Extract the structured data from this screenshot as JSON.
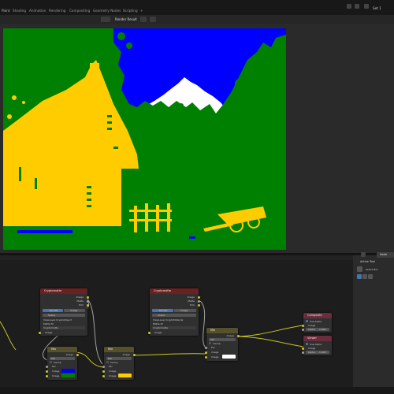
{
  "workspace_tabs": [
    "Paint",
    "Shading",
    "Animation",
    "Rendering",
    "Compositing",
    "Geometry Nodes",
    "Scripting",
    "+"
  ],
  "scene_label": "Set 1",
  "image_header": {
    "title": "Render Result"
  },
  "render_colors": {
    "sky": "#0000ff",
    "vegetation": "#008000",
    "building": "#ffcc00",
    "mountain": "#ffffff",
    "ground": "#ffcc00"
  },
  "side_panel": {
    "tab": "Node",
    "title": "Active Tool",
    "tool": "Select Box"
  },
  "nodes": {
    "layer1": {
      "title": "Cryptomatte",
      "outputs": [
        "Image",
        "Matte",
        "Pick"
      ],
      "mode_buttons": [
        "Render",
        "Image"
      ],
      "layer_field": "Scene",
      "rows": [
        "ViewLayer.CryptoObject",
        "Matte ID",
        "Cryptomatte"
      ],
      "input": "Image"
    },
    "layer2": {
      "title": "Cryptomatte",
      "outputs": [
        "Image",
        "Matte",
        "Pick"
      ],
      "mode_buttons": [
        "Render",
        "Image"
      ],
      "layer_field": "Scene",
      "rows": [
        "ViewLayer.CryptoMaterial",
        "Matte ID",
        "Cryptomatte"
      ],
      "input": "Image"
    },
    "mix1": {
      "title": "Mix",
      "output": "Image",
      "blend": "Mix",
      "clamp": "Clamp",
      "fac": "Fac",
      "inputs": [
        "Image",
        "Image"
      ]
    },
    "mix2": {
      "title": "Mix",
      "output": "Image",
      "blend": "Mix",
      "clamp": "Clamp",
      "fac": "Fac",
      "inputs": [
        "Image",
        "Image"
      ]
    },
    "mix3": {
      "title": "Mix",
      "output": "Image",
      "blend": "Mix",
      "clamp": "Clamp",
      "fac": "Fac",
      "inputs": [
        "Image",
        "Image"
      ]
    },
    "composite": {
      "title": "Composite",
      "use_alpha": "Use Alpha",
      "input": "Image",
      "fields": [
        "Alpha",
        "1.000"
      ]
    },
    "viewer": {
      "title": "Viewer",
      "use_alpha": "Use Alpha",
      "input": "Image",
      "fields": [
        "Alpha",
        "1.000"
      ]
    }
  },
  "swatches": {
    "blue": "#0000ff",
    "green": "#008000",
    "yellow": "#ffcc00",
    "white": "#ffffff"
  }
}
